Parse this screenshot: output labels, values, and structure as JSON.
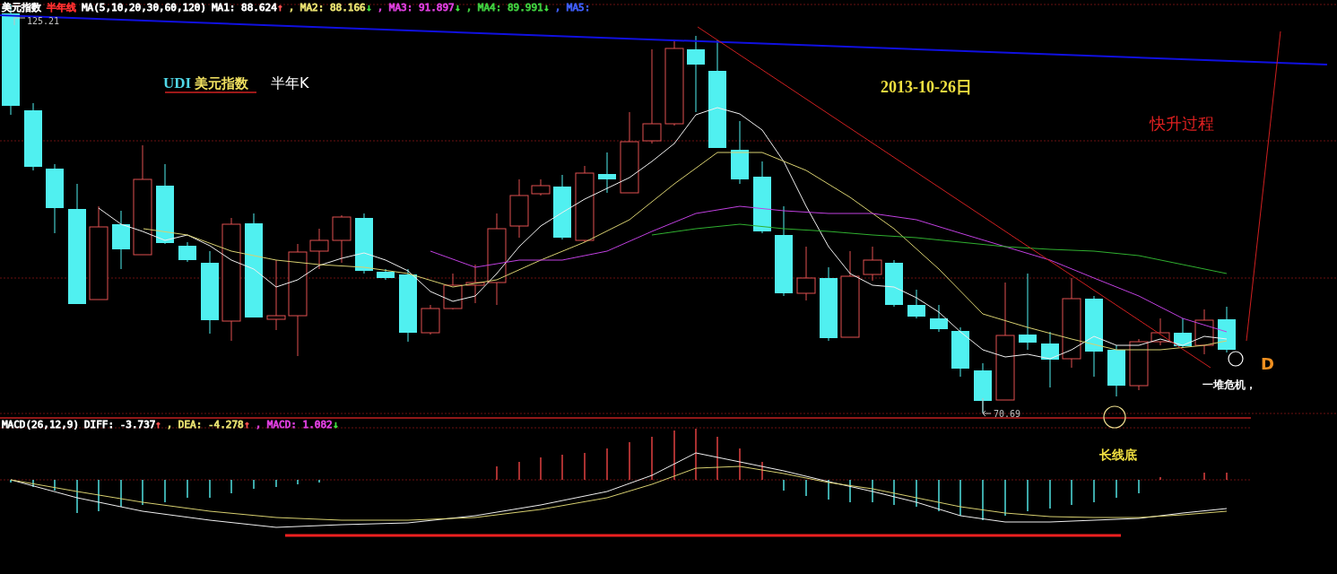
{
  "price_panel": {
    "legend": [
      {
        "text": "美元指数",
        "color": "#ffffff"
      },
      {
        "text": "半年线",
        "color": "#ff3030"
      },
      {
        "text": "MA(5,10,20,30,60,120)",
        "color": "#ffffff"
      },
      {
        "text": "MA1: 88.624",
        "arrow": {
          "text": "↑",
          "color": "#ff5050"
        },
        "color": "#ffffff"
      },
      {
        "text": ", MA2: 88.166",
        "arrow": {
          "text": "↓",
          "color": "#40e040"
        },
        "color": "#e8e070"
      },
      {
        "text": ", MA3: 91.897",
        "arrow": {
          "text": "↓",
          "color": "#40e040"
        },
        "color": "#e040e0"
      },
      {
        "text": ", MA4: 89.991",
        "arrow": {
          "text": "↓",
          "color": "#40e040"
        },
        "color": "#40d040"
      },
      {
        "text": ", MA5:",
        "color": "#4060ff"
      }
    ],
    "high_label": "125.21",
    "low_label": "70.69",
    "annotations": [
      {
        "kind": "title",
        "code": "UDI",
        "text": "美元指数"
      },
      {
        "kind": "period",
        "text": "半年K"
      },
      {
        "kind": "date",
        "text": "2013-10-26日"
      },
      {
        "kind": "process",
        "text": "快升过程"
      },
      {
        "kind": "point",
        "text": "D"
      },
      {
        "kind": "note",
        "text": "一堆危机，"
      }
    ]
  },
  "macd_panel": {
    "legend": [
      {
        "text": "MACD(26,12,9) ",
        "color": "#ffffff"
      },
      {
        "text": "DIFF: -3.737",
        "arrow": {
          "text": "↑",
          "color": "#ff5050"
        },
        "color": "#ffffff"
      },
      {
        "text": ", DEA: -4.278",
        "arrow": {
          "text": "↑",
          "color": "#ff5050"
        },
        "color": "#e8e070"
      },
      {
        "text": ", MACD: 1.082",
        "arrow": {
          "text": "↓",
          "color": "#40e040"
        },
        "color": "#e040e0"
      }
    ],
    "annotations": [
      {
        "kind": "bottom",
        "text": "长线底"
      }
    ]
  }
}
